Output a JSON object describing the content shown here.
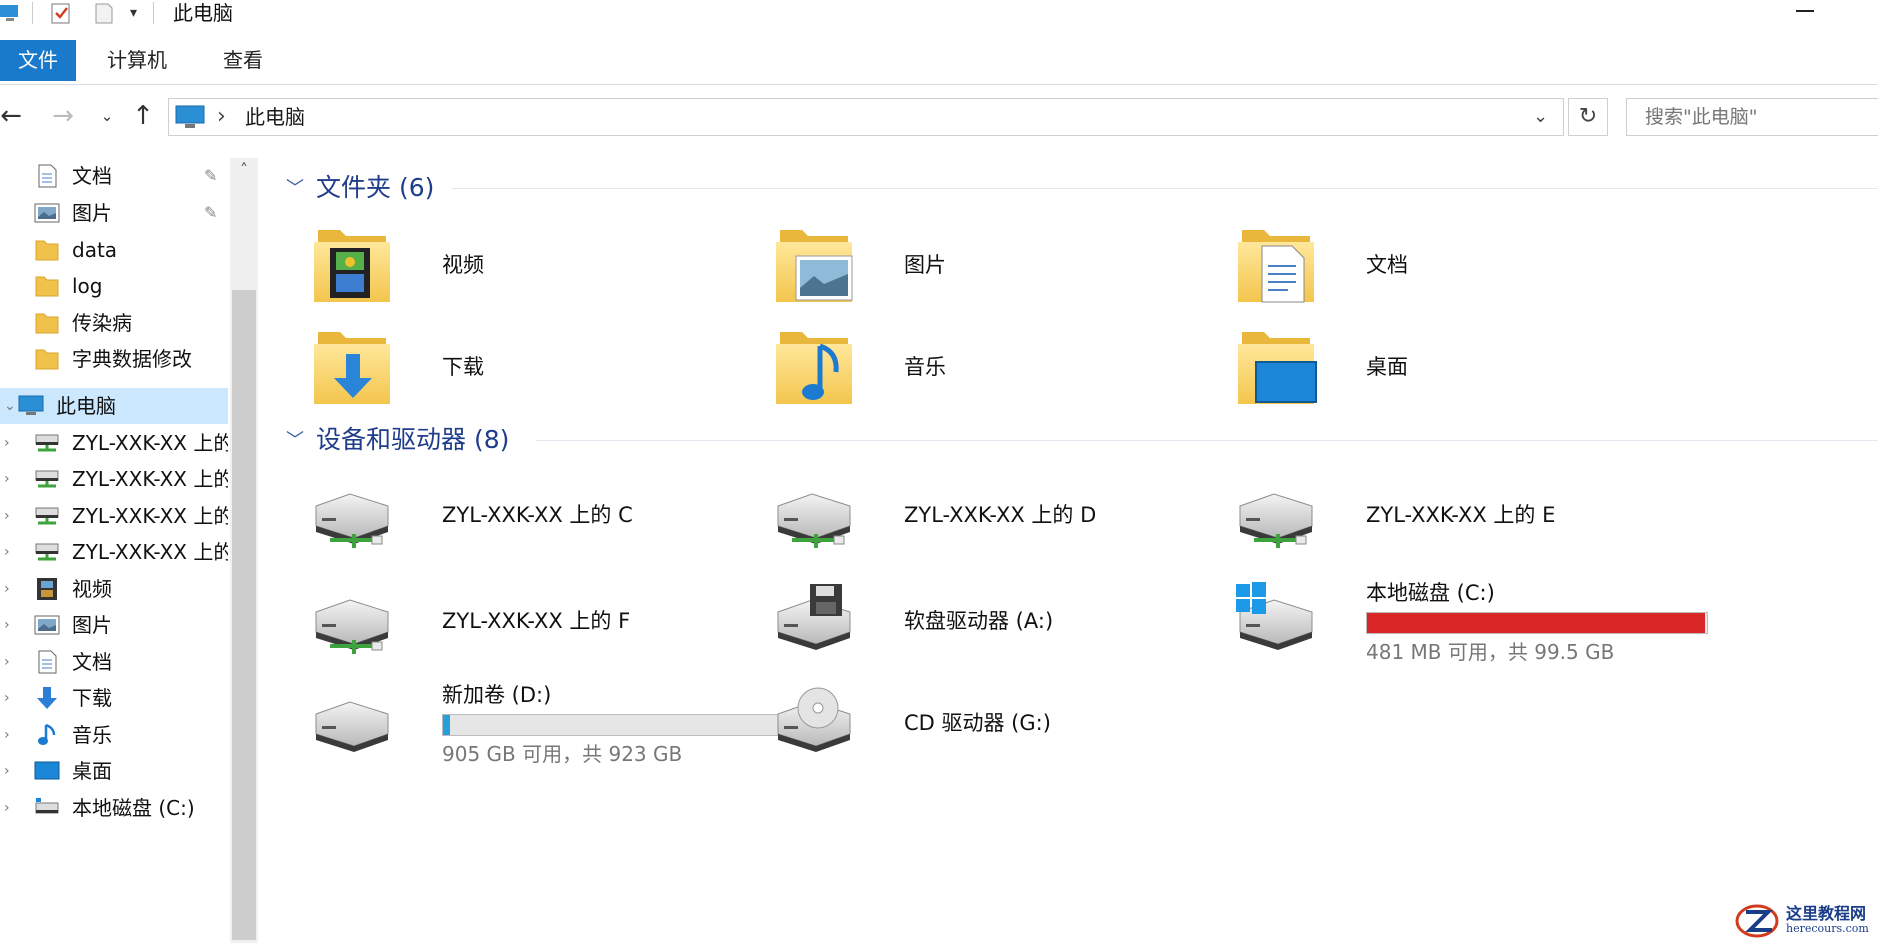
{
  "window": {
    "title": "此电脑"
  },
  "ribbon": {
    "tabs": [
      {
        "label": "文件",
        "active": true
      },
      {
        "label": "计算机"
      },
      {
        "label": "查看"
      }
    ]
  },
  "address": {
    "path_label": "此电脑",
    "search_placeholder": "搜索\"此电脑\""
  },
  "sidebar": {
    "items": [
      {
        "label": "文档",
        "icon": "document-icon",
        "pinned": true
      },
      {
        "label": "图片",
        "icon": "picture-icon",
        "pinned": true
      },
      {
        "label": "data",
        "icon": "folder-icon"
      },
      {
        "label": "log",
        "icon": "folder-icon"
      },
      {
        "label": "传染病",
        "icon": "folder-icon"
      },
      {
        "label": "字典数据修改",
        "icon": "folder-icon"
      },
      {
        "label": "此电脑",
        "icon": "computer-icon",
        "selected": true,
        "expanded": true
      },
      {
        "label": "ZYL-XXK-XX 上的 C",
        "icon": "network-drive-icon"
      },
      {
        "label": "ZYL-XXK-XX 上的 D",
        "icon": "network-drive-icon"
      },
      {
        "label": "ZYL-XXK-XX 上的 E",
        "icon": "network-drive-icon"
      },
      {
        "label": "ZYL-XXK-XX 上的 F",
        "icon": "network-drive-icon"
      },
      {
        "label": "视频",
        "icon": "video-icon"
      },
      {
        "label": "图片",
        "icon": "picture-icon"
      },
      {
        "label": "文档",
        "icon": "document-icon"
      },
      {
        "label": "下载",
        "icon": "download-icon"
      },
      {
        "label": "音乐",
        "icon": "music-icon"
      },
      {
        "label": "桌面",
        "icon": "desktop-icon"
      },
      {
        "label": "本地磁盘 (C:)",
        "icon": "local-disk-icon"
      }
    ]
  },
  "folders": {
    "header": "文件夹 (6)",
    "items": [
      {
        "label": "视频",
        "icon": "video-folder-icon"
      },
      {
        "label": "图片",
        "icon": "picture-folder-icon"
      },
      {
        "label": "文档",
        "icon": "document-folder-icon"
      },
      {
        "label": "下载",
        "icon": "download-folder-icon"
      },
      {
        "label": "音乐",
        "icon": "music-folder-icon"
      },
      {
        "label": "桌面",
        "icon": "desktop-folder-icon"
      }
    ]
  },
  "devices": {
    "header": "设备和驱动器 (8)",
    "items": [
      {
        "label": "ZYL-XXK-XX 上的 C",
        "icon": "network-drive-icon"
      },
      {
        "label": "ZYL-XXK-XX 上的 D",
        "icon": "network-drive-icon"
      },
      {
        "label": "ZYL-XXK-XX 上的 E",
        "icon": "network-drive-icon"
      },
      {
        "label": "ZYL-XXK-XX 上的 F",
        "icon": "network-drive-icon"
      },
      {
        "label": "软盘驱动器 (A:)",
        "icon": "floppy-drive-icon"
      },
      {
        "label": "本地磁盘 (C:)",
        "icon": "windows-disk-icon",
        "usage_fraction": 0.995,
        "bar_color": "#da2626",
        "space": "481 MB 可用，共 99.5 GB"
      },
      {
        "label": "新加卷 (D:)",
        "icon": "local-disk-icon",
        "usage_fraction": 0.02,
        "bar_color": "#26a0da",
        "space": "905 GB 可用，共 923 GB"
      },
      {
        "label": "CD 驱动器 (G:)",
        "icon": "cd-drive-icon"
      }
    ]
  },
  "watermark": {
    "title": "这里教程网",
    "subtitle": "herecours.com"
  }
}
